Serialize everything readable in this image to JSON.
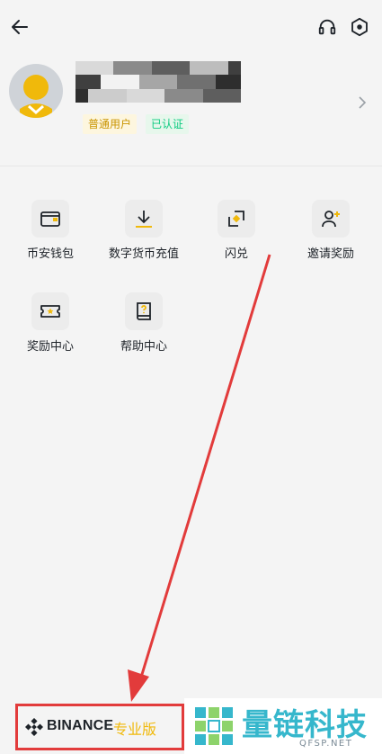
{
  "header": {
    "back_icon": "arrow-left-icon",
    "support_icon": "headset-icon",
    "settings_icon": "hexagon-settings-icon"
  },
  "profile": {
    "badge_normal": "普通用户",
    "badge_verified": "已认证"
  },
  "menu": [
    {
      "label": "币安钱包",
      "icon": "wallet-icon"
    },
    {
      "label": "数字货币充值",
      "icon": "download-icon"
    },
    {
      "label": "闪兑",
      "icon": "swap-icon"
    },
    {
      "label": "邀请奖励",
      "icon": "invite-user-icon"
    },
    {
      "label": "奖励中心",
      "icon": "ticket-star-icon"
    },
    {
      "label": "帮助中心",
      "icon": "help-book-icon"
    }
  ],
  "footer": {
    "brand": "BINANCE",
    "edition": "专业版"
  },
  "watermark": {
    "title": "量链科技",
    "domain": "QFSP.NET"
  },
  "colors": {
    "accent": "#f0b90b",
    "verified": "#0ecb81",
    "annotation": "#e23b3b",
    "watermark": "#36b7cc"
  }
}
